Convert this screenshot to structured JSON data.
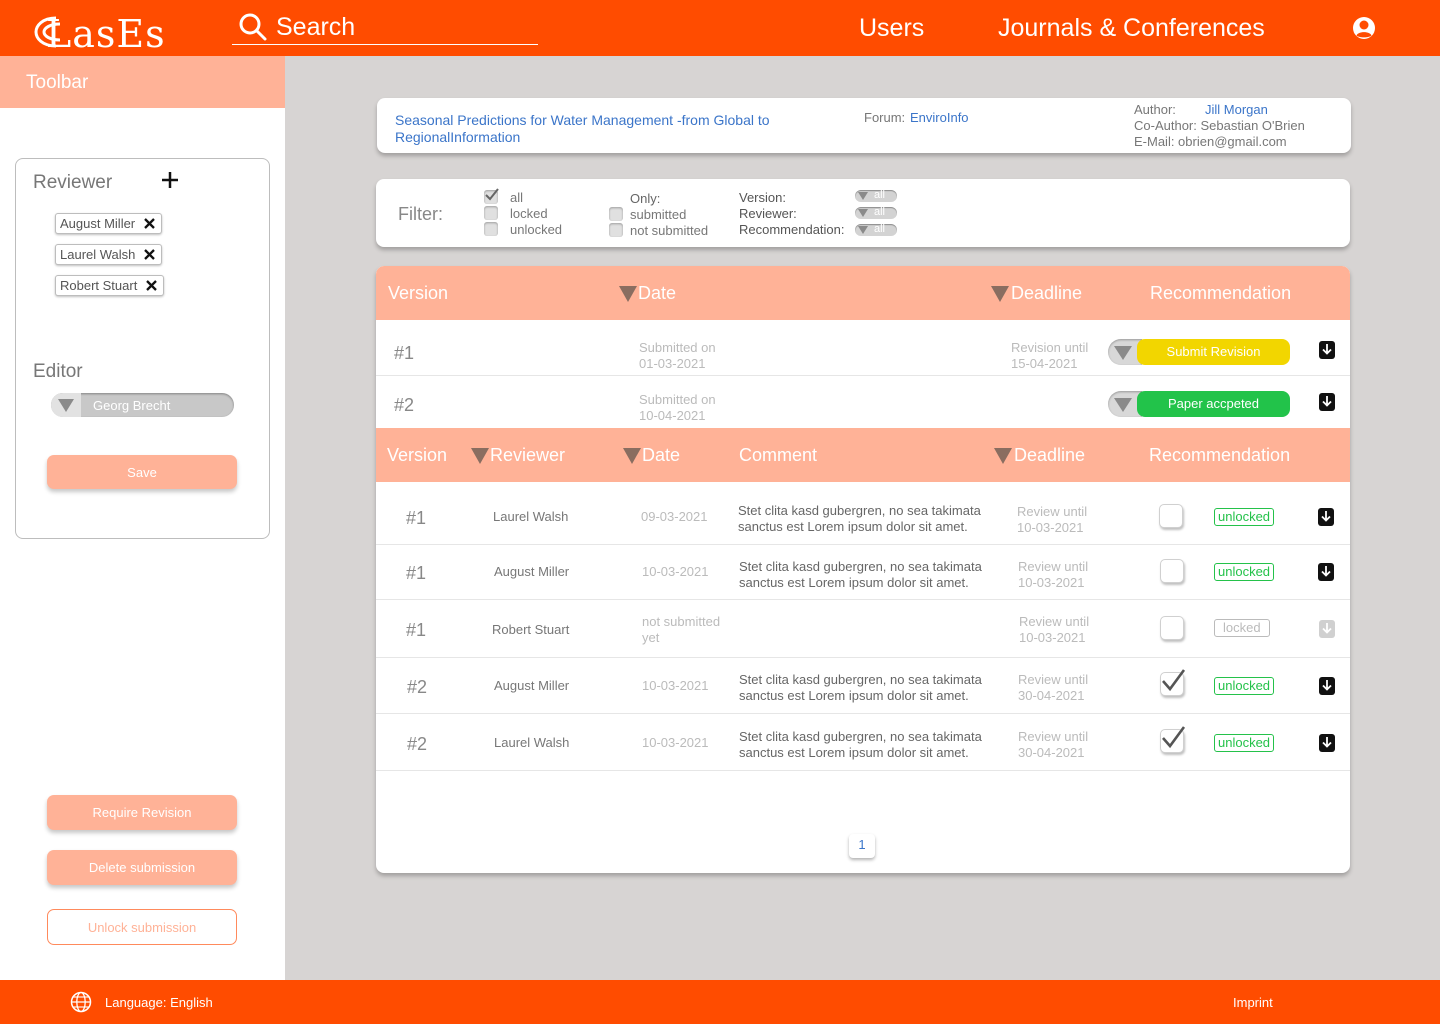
{
  "header": {
    "logo_text": "LasEs",
    "search_placeholder": "Search",
    "nav": [
      "Users",
      "Journals & Conferences"
    ]
  },
  "sidebar": {
    "toolbar_title": "Toolbar",
    "reviewer_label": "Reviewer",
    "reviewers": [
      "August Miller",
      "Laurel Walsh",
      "Robert Stuart"
    ],
    "editor_label": "Editor",
    "editor_value": "Georg Brecht",
    "save_label": "Save",
    "require_revision_label": "Require Revision",
    "delete_submission_label": "Delete submission",
    "unlock_submission_label": "Unlock submission"
  },
  "paper": {
    "title": "Seasonal Predictions for Water Management -from Global to RegionalInformation",
    "forum_label": "Forum:",
    "forum_value": "EnviroInfo",
    "author_label": "Author:",
    "author_value": "Jill Morgan",
    "coauthor": "Co-Author: Sebastian O'Brien",
    "email": "E-Mail: obrien@gmail.com"
  },
  "filter": {
    "label": "Filter:",
    "group1": [
      "all",
      "locked",
      "unlocked"
    ],
    "only_label": "Only:",
    "group2": [
      "submitted",
      "not submitted"
    ],
    "selects": [
      {
        "label": "Version:",
        "value": "all"
      },
      {
        "label": "Reviewer:",
        "value": "all"
      },
      {
        "label": "Recommendation:",
        "value": "all"
      }
    ]
  },
  "versions_table": {
    "headers": [
      "Version",
      "Date",
      "Deadline",
      "Recommendation"
    ],
    "rows": [
      {
        "version": "#1",
        "date_label": "Submitted  on",
        "date": "01-03-2021",
        "deadline_label": "Revision until",
        "deadline": "15-04-2021",
        "status": "Submit Revision",
        "status_color": "#f2d600"
      },
      {
        "version": "#2",
        "date_label": "Submitted  on",
        "date": "10-04-2021",
        "deadline_label": "",
        "deadline": "",
        "status": "Paper accpeted",
        "status_color": "#22c34a"
      }
    ]
  },
  "reviews_table": {
    "headers": [
      "Version",
      "Reviewer",
      "Date",
      "Comment",
      "Deadline",
      "Recommendation"
    ],
    "rows": [
      {
        "version": "#1",
        "reviewer": "Laurel  Walsh",
        "date": "09-03-2021",
        "comment1": "Stet clita kasd gubergren, no sea takimata",
        "comment2": "sanctus est Lorem ipsum dolor sit amet.",
        "deadline_label": "Review until",
        "deadline": "10-03-2021",
        "checked": false,
        "lock": "unlocked"
      },
      {
        "version": "#1",
        "reviewer": "August Miller",
        "date": "10-03-2021",
        "comment1": "Stet clita kasd gubergren, no sea takimata",
        "comment2": "sanctus est Lorem ipsum dolor sit amet.",
        "deadline_label": "Review until",
        "deadline": "10-03-2021",
        "checked": false,
        "lock": "unlocked"
      },
      {
        "version": "#1",
        "reviewer": "Robert Stuart",
        "date": "not submitted",
        "date2": "yet",
        "comment1": "",
        "comment2": "",
        "deadline_label": "Review until",
        "deadline": "10-03-2021",
        "checked": false,
        "lock": "locked"
      },
      {
        "version": "#2",
        "reviewer": "August Miller",
        "date": "10-03-2021",
        "comment1": "Stet clita kasd gubergren, no sea takimata",
        "comment2": "sanctus est Lorem ipsum dolor sit amet.",
        "deadline_label": "Review until",
        "deadline": "30-04-2021",
        "checked": true,
        "lock": "unlocked"
      },
      {
        "version": "#2",
        "reviewer": "Laurel Walsh",
        "date": "10-03-2021",
        "comment1": "Stet clita kasd gubergren, no sea takimata",
        "comment2": "sanctus est Lorem ipsum dolor sit amet.",
        "deadline_label": "Review until",
        "deadline": "30-04-2021",
        "checked": true,
        "lock": "unlocked"
      }
    ]
  },
  "pagination": {
    "current": "1"
  },
  "footer": {
    "language": "Language: English",
    "imprint": "Imprint"
  },
  "colors": {
    "brand": "#ff4c00",
    "peach": "#ffb297",
    "link": "#3b75c9",
    "success": "#22c34a",
    "warning": "#f2d600"
  }
}
